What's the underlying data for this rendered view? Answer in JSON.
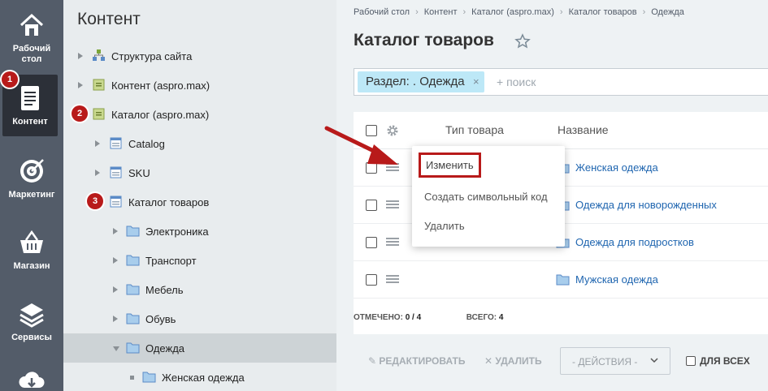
{
  "leftbar": {
    "items": [
      {
        "label_line1": "Рабочий",
        "label_line2": "стол",
        "icon": "house-icon"
      },
      {
        "label_line1": "Контент",
        "label_line2": "",
        "icon": "document-icon"
      },
      {
        "label_line1": "Маркетинг",
        "label_line2": "",
        "icon": "target-icon"
      },
      {
        "label_line1": "Магазин",
        "label_line2": "",
        "icon": "basket-icon"
      },
      {
        "label_line1": "Сервисы",
        "label_line2": "",
        "icon": "layers-icon"
      },
      {
        "label_line1": "",
        "label_line2": "",
        "icon": "cloud-download-icon"
      }
    ]
  },
  "badges": [
    "1",
    "2",
    "3"
  ],
  "tree": {
    "title": "Контент",
    "nodes": [
      {
        "label": "Структура сайта"
      },
      {
        "label": "Контент (aspro.max)"
      },
      {
        "label": "Каталог (aspro.max)"
      },
      {
        "label": "Catalog"
      },
      {
        "label": "SKU"
      },
      {
        "label": "Каталог товаров"
      },
      {
        "label": "Электроника"
      },
      {
        "label": "Транспорт"
      },
      {
        "label": "Мебель"
      },
      {
        "label": "Обувь"
      },
      {
        "label": "Одежда"
      },
      {
        "label": "Женская одежда"
      }
    ]
  },
  "breadcrumb": [
    "Рабочий стол",
    "Контент",
    "Каталог (aspro.max)",
    "Каталог товаров",
    "Одежда"
  ],
  "page": {
    "title": "Каталог товаров"
  },
  "filter": {
    "chip": "Раздел: . Одежда",
    "chip_remove": "×",
    "placeholder": "+ поиск"
  },
  "grid": {
    "col_type": "Тип товара",
    "col_name": "Название",
    "rows": [
      {
        "name": "Женская одежда"
      },
      {
        "name": "Одежда для новорожденных"
      },
      {
        "name": "Одежда для подростков"
      },
      {
        "name": "Мужская одежда"
      }
    ]
  },
  "stats": {
    "marked_label": "ОТМЕЧЕНО:",
    "marked_value": "0 / 4",
    "total_label": "ВСЕГО:",
    "total_value": "4"
  },
  "actions": {
    "edit": "РЕДАКТИРОВАТЬ",
    "delete": "УДАЛИТЬ",
    "select": "- ДЕЙСТВИЯ -",
    "for_all": "ДЛЯ ВСЕХ"
  },
  "popup": {
    "items": [
      "Изменить",
      "Создать символьный код",
      "Удалить"
    ]
  },
  "colors": {
    "sidebar": "#535c69",
    "accent_red": "#b81a1a",
    "link": "#2066b0",
    "chip": "#bde8f7"
  }
}
